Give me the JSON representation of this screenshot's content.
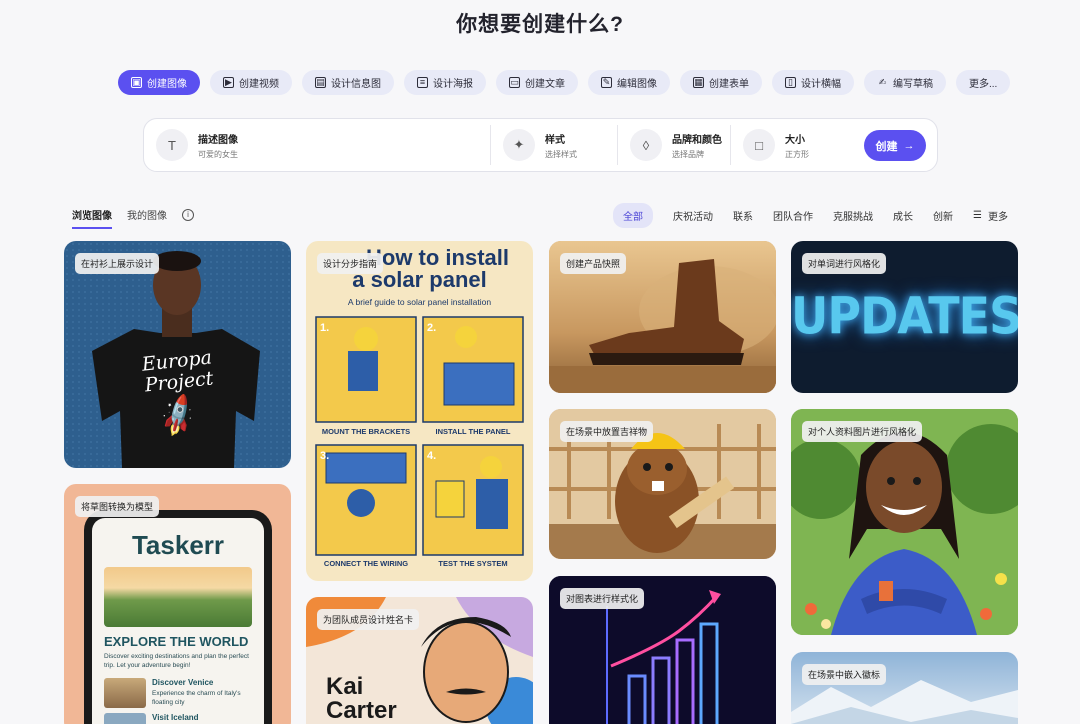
{
  "title": "你想要创建什么?",
  "chips": [
    {
      "label": "创建图像",
      "icon": "image-icon",
      "active": true
    },
    {
      "label": "创建视频",
      "icon": "video-icon"
    },
    {
      "label": "设计信息图",
      "icon": "infographic-icon"
    },
    {
      "label": "设计海报",
      "icon": "poster-icon"
    },
    {
      "label": "创建文章",
      "icon": "article-icon"
    },
    {
      "label": "编辑图像",
      "icon": "edit-image-icon"
    },
    {
      "label": "创建表单",
      "icon": "form-icon"
    },
    {
      "label": "设计横幅",
      "icon": "banner-icon"
    },
    {
      "label": "编写草稿",
      "icon": "pen-icon"
    },
    {
      "label": "更多..."
    }
  ],
  "prompt": {
    "describe_label": "描述图像",
    "describe_value": "可爱的女生",
    "style_label": "样式",
    "style_value": "选择样式",
    "brand_label": "品牌和颜色",
    "brand_value": "选择品牌",
    "size_label": "大小",
    "size_value": "正方形",
    "create_label": "创建"
  },
  "browse": {
    "tab_browse": "浏览图像",
    "tab_mine": "我的图像"
  },
  "filters": [
    "全部",
    "庆祝活动",
    "联系",
    "团队合作",
    "克服挑战",
    "成长",
    "创新"
  ],
  "filters_more": "更多",
  "cards": {
    "tshirt": {
      "tag": "在衬衫上展示设计",
      "shirt_line1": "Europa",
      "shirt_line2": "Project"
    },
    "solar": {
      "tag": "设计分步指南",
      "heading1": "How to install",
      "heading2": "a solar panel",
      "subtitle": "A brief guide to solar panel installation",
      "steps": [
        "MOUNT THE BRACKETS",
        "INSTALL THE PANEL",
        "CONNECT THE WIRING",
        "TEST THE SYSTEM"
      ]
    },
    "boot": {
      "tag": "创建产品快照"
    },
    "updates": {
      "tag": "对单词进行风格化",
      "word": "UPDATES"
    },
    "sketch": {
      "tag": "将草图转换为模型",
      "app": "Taskerr",
      "headline": "EXPLORE THE WORLD",
      "body": "Discover exciting destinations and plan the perfect trip. Let your adventure begin!",
      "item1_title": "Discover Venice",
      "item1_body": "Experience the charm of Italy's floating city",
      "item2_title": "Visit Iceland"
    },
    "beaver": {
      "tag": "在场景中放置吉祥物"
    },
    "avatar": {
      "tag": "对个人资料图片进行风格化"
    },
    "namecard": {
      "tag": "为团队成员设计姓名卡",
      "first": "Kai",
      "last": "Carter"
    },
    "chart": {
      "tag": "对图表进行样式化"
    },
    "scene": {
      "tag": "在场景中嵌入徽标"
    }
  }
}
